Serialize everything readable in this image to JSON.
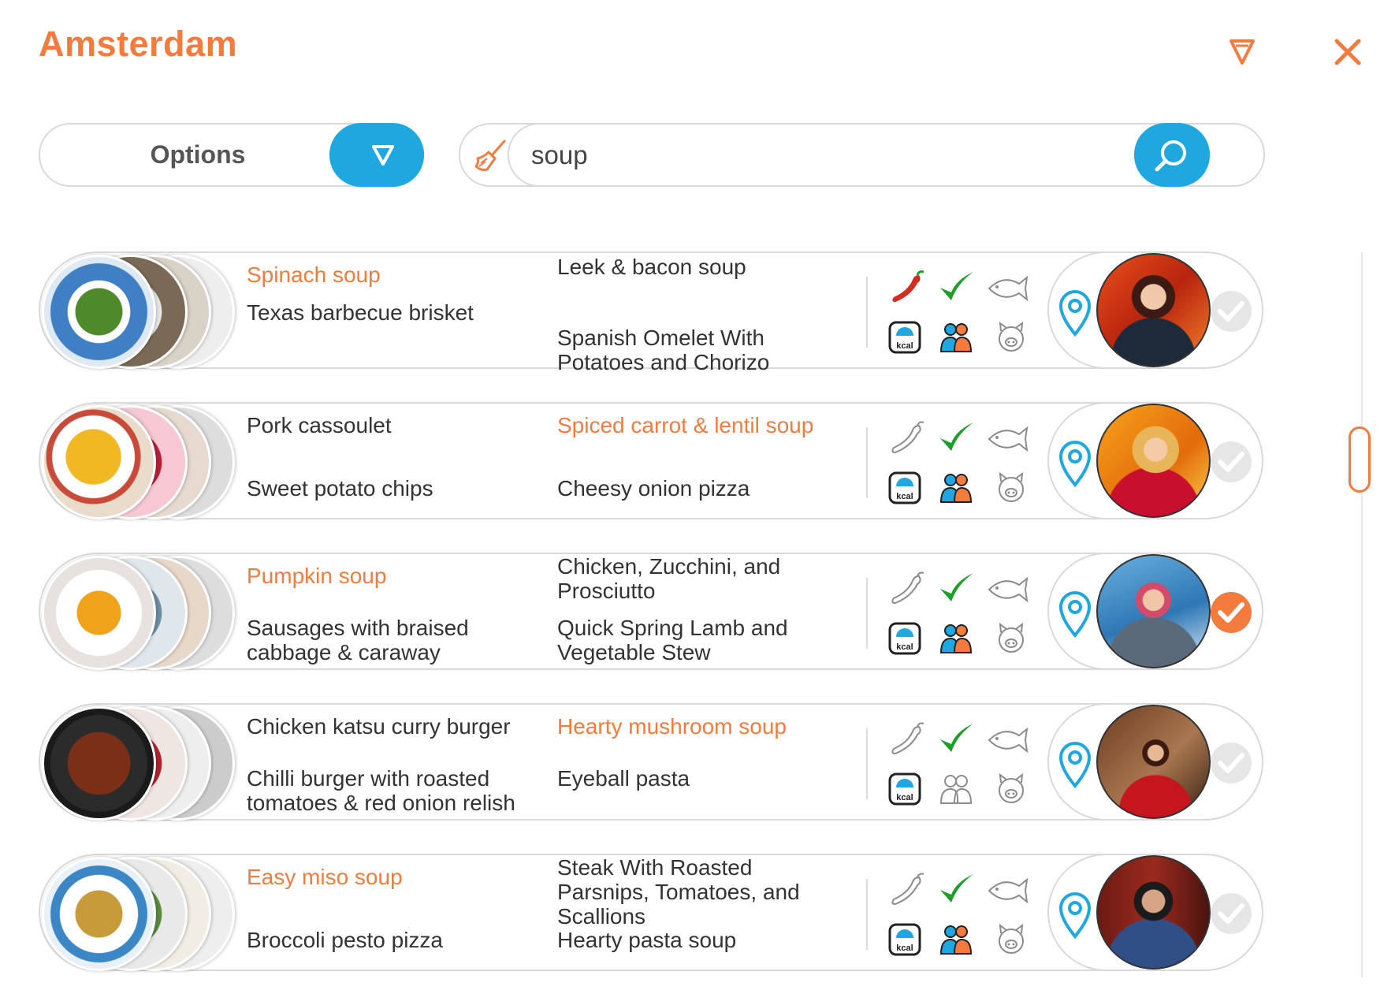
{
  "window": {
    "title": "Amsterdam"
  },
  "header": {
    "filter_icon": "filter-triangle-icon",
    "close_icon": "close-icon"
  },
  "options": {
    "label": "Options"
  },
  "search": {
    "value": "soup",
    "clear_icon": "broom-icon",
    "submit_icon": "search-icon"
  },
  "colors": {
    "accent": "#f47b3e",
    "blue": "#1fa8e0",
    "green": "#1e9e2a",
    "red": "#d62b1f",
    "muted": "#8c8c8c"
  },
  "rows": [
    {
      "items": [
        {
          "text": "Spinach soup",
          "highlight": true
        },
        {
          "text": "Leek & bacon soup",
          "highlight": false
        },
        {
          "text": "Texas barbecue brisket",
          "highlight": false
        },
        {
          "text": "Spanish Omelet With Potatoes and Chorizo",
          "highlight": false
        }
      ],
      "spicy": true,
      "vegetarian": true,
      "fish": false,
      "kcal": true,
      "people": true,
      "pork": false,
      "selected": false
    },
    {
      "items": [
        {
          "text": "Pork cassoulet",
          "highlight": false
        },
        {
          "text": "Spiced carrot & lentil soup",
          "highlight": true
        },
        {
          "text": "Sweet potato chips",
          "highlight": false
        },
        {
          "text": "Cheesy onion pizza",
          "highlight": false
        }
      ],
      "spicy": false,
      "vegetarian": true,
      "fish": false,
      "kcal": true,
      "people": true,
      "pork": false,
      "selected": false
    },
    {
      "items": [
        {
          "text": "Pumpkin soup",
          "highlight": true
        },
        {
          "text": "Chicken, Zucchini, and Prosciutto",
          "highlight": false
        },
        {
          "text": "Sausages with braised cabbage & caraway",
          "highlight": false
        },
        {
          "text": "Quick Spring Lamb and Vegetable Stew",
          "highlight": false
        }
      ],
      "spicy": false,
      "vegetarian": true,
      "fish": false,
      "kcal": true,
      "people": true,
      "pork": false,
      "selected": true
    },
    {
      "items": [
        {
          "text": "Chicken katsu curry burger",
          "highlight": false
        },
        {
          "text": "Hearty mushroom soup",
          "highlight": true
        },
        {
          "text": "Chilli burger with roasted tomatoes & red onion relish",
          "highlight": false
        },
        {
          "text": "Eyeball pasta",
          "highlight": false
        }
      ],
      "spicy": false,
      "vegetarian": true,
      "fish": false,
      "kcal": true,
      "people": false,
      "pork": false,
      "selected": false
    },
    {
      "items": [
        {
          "text": "Easy miso soup",
          "highlight": true
        },
        {
          "text": "Steak With Roasted Parsnips, Tomatoes, and Scallions",
          "highlight": false
        },
        {
          "text": "Broccoli pesto pizza",
          "highlight": false
        },
        {
          "text": "Hearty pasta soup",
          "highlight": false
        }
      ],
      "spicy": false,
      "vegetarian": true,
      "fish": false,
      "kcal": true,
      "people": true,
      "pork": false,
      "selected": false
    }
  ],
  "icons": {
    "kcal_label": "kcal"
  }
}
